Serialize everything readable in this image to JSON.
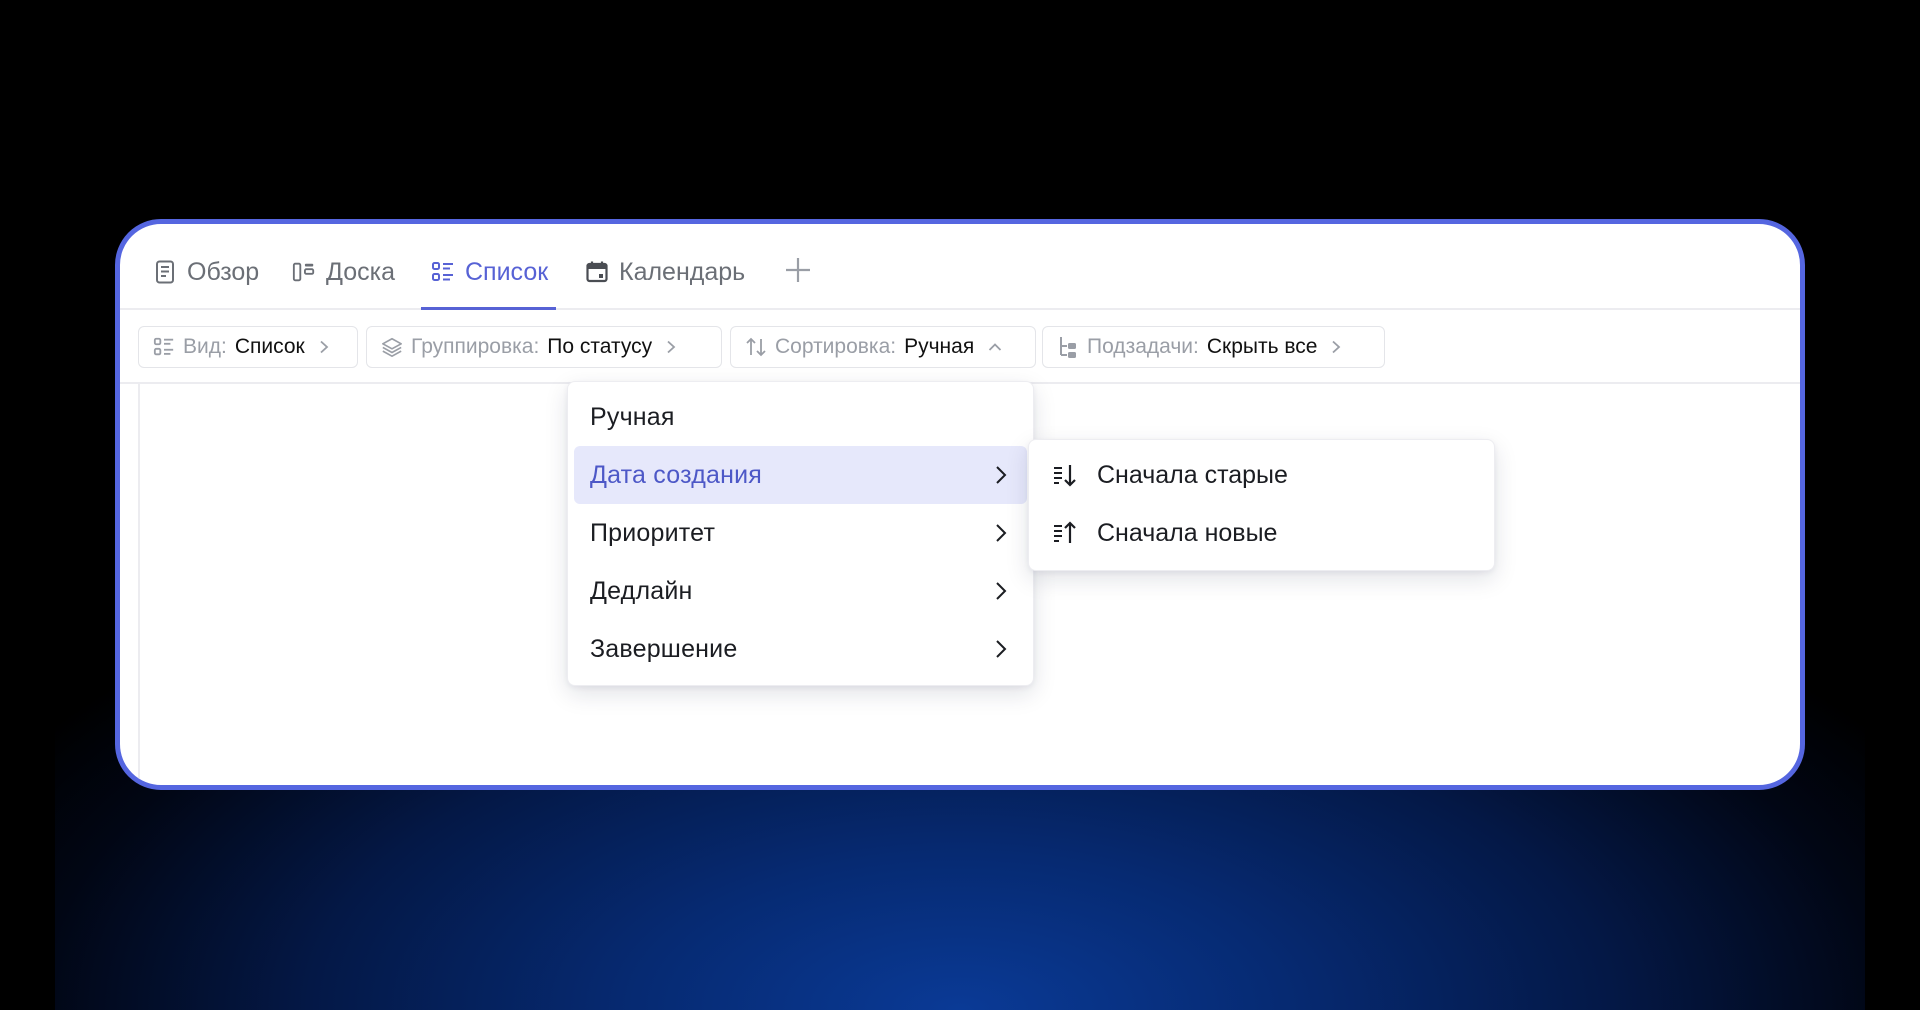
{
  "tabs": [
    {
      "label": "Обзор",
      "icon": "document-icon"
    },
    {
      "label": "Доска",
      "icon": "board-icon"
    },
    {
      "label": "Список",
      "icon": "list-icon",
      "active": true
    },
    {
      "label": "Календарь",
      "icon": "calendar-icon"
    }
  ],
  "add_tab_icon": "plus-icon",
  "toolbar": {
    "view": {
      "key": "Вид:",
      "value": "Список"
    },
    "grouping": {
      "key": "Группировка:",
      "value": "По статусу"
    },
    "sorting": {
      "key": "Сортировка:",
      "value": "Ручная"
    },
    "subtasks": {
      "key": "Подзадачи:",
      "value": "Скрыть все"
    }
  },
  "sort_menu": {
    "items": [
      {
        "label": "Ручная",
        "submenu": false
      },
      {
        "label": "Дата создания",
        "submenu": true,
        "highlighted": true
      },
      {
        "label": "Приоритет",
        "submenu": true
      },
      {
        "label": "Дедлайн",
        "submenu": true
      },
      {
        "label": "Завершение",
        "submenu": true
      }
    ]
  },
  "sort_submenu": {
    "items": [
      {
        "label": "Сначала старые",
        "icon": "sort-ascending-icon"
      },
      {
        "label": "Сначала новые",
        "icon": "sort-descending-icon"
      }
    ]
  },
  "colors": {
    "accent": "#5762d5",
    "card_border": "#5566e0",
    "highlight_bg": "#e6e8fb"
  }
}
